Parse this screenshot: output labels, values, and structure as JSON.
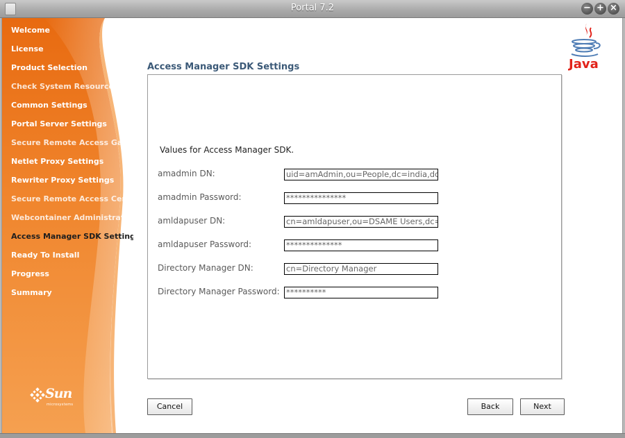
{
  "window": {
    "title": "Portal 7.2"
  },
  "sidebar": {
    "steps": [
      {
        "label": "Welcome",
        "state": "done"
      },
      {
        "label": "License",
        "state": "done"
      },
      {
        "label": "Product Selection",
        "state": "done"
      },
      {
        "label": "Check System Resources",
        "state": "faded"
      },
      {
        "label": "Common Settings",
        "state": "done"
      },
      {
        "label": "Portal Server Settings",
        "state": "done"
      },
      {
        "label": "Secure Remote Access Gateway",
        "state": "faded"
      },
      {
        "label": "Netlet Proxy Settings",
        "state": "done"
      },
      {
        "label": "Rewriter Proxy Settings",
        "state": "done"
      },
      {
        "label": "Secure Remote Access Certificate",
        "state": "faded"
      },
      {
        "label": "Webcontainer Administration Settings",
        "state": "faded"
      },
      {
        "label": "Access Manager SDK Settings",
        "state": "current"
      },
      {
        "label": "Ready To Install",
        "state": "todo"
      },
      {
        "label": "Progress",
        "state": "todo"
      },
      {
        "label": "Summary",
        "state": "todo"
      }
    ],
    "logo_text": "Sun",
    "logo_subtext": "microsystems"
  },
  "java_logo_text": "Java",
  "page": {
    "title": "Access Manager SDK Settings",
    "intro": "Values for Access Manager SDK.",
    "fields": [
      {
        "label": "amadmin DN:",
        "value": "uid=amAdmin,ou=People,dc=india,dc=sun,dc=com"
      },
      {
        "label": "amadmin Password:",
        "value": "***************"
      },
      {
        "label": "amldapuser DN:",
        "value": "cn=amldapuser,ou=DSAME Users,dc=india,dc=sun,dc=com"
      },
      {
        "label": "amldapuser Password:",
        "value": "**************"
      },
      {
        "label": "Directory Manager DN:",
        "value": "cn=Directory Manager"
      },
      {
        "label": "Directory Manager Password:",
        "value": "**********"
      }
    ]
  },
  "buttons": {
    "cancel": "Cancel",
    "back": "Back",
    "next": "Next"
  },
  "colors": {
    "sidebar_orange": "#ee7a1a",
    "title_blue": "#3c5a78"
  }
}
